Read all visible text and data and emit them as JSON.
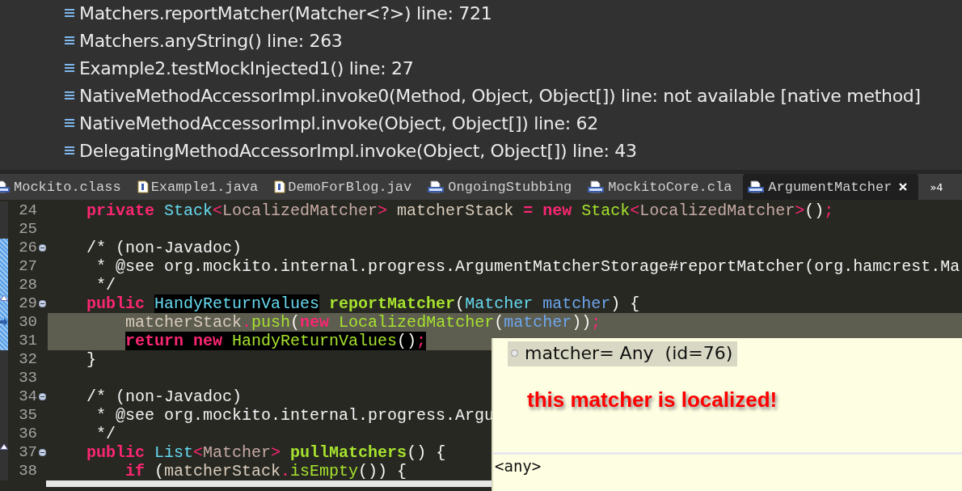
{
  "stack_frames": [
    {
      "text": "Matchers.reportMatcher(Matcher<?>) line: 721"
    },
    {
      "text": "Matchers.anyString() line: 263"
    },
    {
      "text": "Example2.testMockInjected1() line: 27"
    },
    {
      "text": "NativeMethodAccessorImpl.invoke0(Method, Object, Object[]) line: not available [native method]"
    },
    {
      "text": "NativeMethodAccessorImpl.invoke(Object, Object[]) line: 62"
    },
    {
      "text": "DelegatingMethodAccessorImpl.invoke(Object, Object[]) line: 43"
    }
  ],
  "editor_tabs": [
    {
      "label": "Mockito.class",
      "kind": "class",
      "selected": false
    },
    {
      "label": "Example1.java",
      "kind": "java",
      "selected": false
    },
    {
      "label": "DemoForBlog.jav",
      "kind": "java",
      "selected": false
    },
    {
      "label": "OngoingStubbing",
      "kind": "class",
      "selected": false
    },
    {
      "label": "MockitoCore.cla",
      "kind": "class",
      "selected": false
    },
    {
      "label": "ArgumentMatcher",
      "kind": "class",
      "selected": true
    }
  ],
  "tab_overflow": "»4",
  "code_lines": [
    {
      "number": "24",
      "selected": false,
      "changed": false,
      "foldable": false,
      "bookmarked": false,
      "current": false,
      "tokens": [
        {
          "text": "    private ",
          "kind": "keyword"
        },
        {
          "text": "Stack",
          "kind": "type"
        },
        {
          "text": "<",
          "kind": "operator"
        },
        {
          "text": "LocalizedMatcher",
          "kind": "generic"
        },
        {
          "text": ">",
          "kind": "operator"
        },
        {
          "text": " matcherStack ",
          "kind": "field"
        },
        {
          "text": "= new ",
          "kind": "keyword"
        },
        {
          "text": "Stack",
          "kind": "call"
        },
        {
          "text": "<",
          "kind": "operator"
        },
        {
          "text": "LocalizedMatcher",
          "kind": "generic"
        },
        {
          "text": ">",
          "kind": "operator"
        },
        {
          "text": "()"
        },
        {
          "text": ";",
          "kind": "operator"
        }
      ]
    },
    {
      "number": "25",
      "selected": false,
      "changed": false,
      "foldable": false,
      "bookmarked": false,
      "current": false
    },
    {
      "number": "26",
      "selected": false,
      "changed": true,
      "foldable": true,
      "bookmarked": false,
      "current": false,
      "tokens": [
        {
          "text": "    /* (non-Javadoc)",
          "kind": "comment"
        }
      ]
    },
    {
      "number": "27",
      "selected": false,
      "changed": true,
      "foldable": false,
      "bookmarked": false,
      "current": false,
      "tokens": [
        {
          "text": "     * @see org.mockito.internal.progress.ArgumentMatcherStorage#reportMatcher(org.hamcrest.Ma",
          "kind": "comment"
        }
      ]
    },
    {
      "number": "28",
      "selected": false,
      "changed": true,
      "foldable": false,
      "bookmarked": false,
      "current": false,
      "tokens": [
        {
          "text": "     */",
          "kind": "comment"
        }
      ]
    },
    {
      "number": "29",
      "selected": false,
      "changed": true,
      "foldable": true,
      "bookmarked": true,
      "current": false,
      "tokens": [
        {
          "text": "    public ",
          "kind": "keyword"
        },
        {
          "text": "HandyReturnValues",
          "kind": "type",
          "marked": true
        },
        {
          "text": " reportMatcher",
          "kind": "decl"
        },
        {
          "text": "("
        },
        {
          "text": "Matcher ",
          "kind": "type"
        },
        {
          "text": "matcher",
          "kind": "param"
        },
        {
          "text": ") {"
        }
      ]
    },
    {
      "number": "30",
      "selected": true,
      "changed": true,
      "foldable": false,
      "bookmarked": false,
      "current": true,
      "tokens": [
        {
          "text": "        matcherStack",
          "kind": "field"
        },
        {
          "text": ".",
          "kind": "operator"
        },
        {
          "text": "push",
          "kind": "call"
        },
        {
          "text": "("
        },
        {
          "text": "new ",
          "kind": "keyword"
        },
        {
          "text": "LocalizedMatcher",
          "kind": "call"
        },
        {
          "text": "("
        },
        {
          "text": "matcher",
          "kind": "param"
        },
        {
          "text": "))"
        },
        {
          "text": ";",
          "kind": "operator"
        }
      ]
    },
    {
      "number": "31",
      "selected": true,
      "changed": true,
      "foldable": false,
      "bookmarked": false,
      "current": false,
      "tokens": [
        {
          "text": "        return new ",
          "kind": "keyword",
          "marked": true
        },
        {
          "text": "HandyReturnValues",
          "kind": "call",
          "marked": true
        },
        {
          "text": "()",
          "marked": true
        },
        {
          "text": ";",
          "kind": "operator",
          "marked": true
        }
      ]
    },
    {
      "number": "32",
      "selected": false,
      "changed": false,
      "foldable": false,
      "bookmarked": false,
      "current": false,
      "tokens": [
        {
          "text": "    }"
        }
      ]
    },
    {
      "number": "33",
      "selected": false,
      "changed": false,
      "foldable": false,
      "bookmarked": false,
      "current": false
    },
    {
      "number": "34",
      "selected": false,
      "changed": false,
      "foldable": true,
      "bookmarked": false,
      "current": false,
      "tokens": [
        {
          "text": "    /* (non-Javadoc)",
          "kind": "comment"
        }
      ]
    },
    {
      "number": "35",
      "selected": false,
      "changed": false,
      "foldable": false,
      "bookmarked": false,
      "current": false,
      "tokens": [
        {
          "text": "     * @see org.mockito.internal.progress.Argu",
          "kind": "comment"
        }
      ]
    },
    {
      "number": "36",
      "selected": false,
      "changed": false,
      "foldable": false,
      "bookmarked": false,
      "current": false,
      "tokens": [
        {
          "text": "     */",
          "kind": "comment"
        }
      ]
    },
    {
      "number": "37",
      "selected": false,
      "changed": false,
      "foldable": true,
      "bookmarked": true,
      "current": false,
      "tokens": [
        {
          "text": "    public ",
          "kind": "keyword"
        },
        {
          "text": "List",
          "kind": "type"
        },
        {
          "text": "<",
          "kind": "operator"
        },
        {
          "text": "Matcher",
          "kind": "generic"
        },
        {
          "text": ">",
          "kind": "operator"
        },
        {
          "text": " pullMatchers",
          "kind": "decl"
        },
        {
          "text": "() {"
        }
      ]
    },
    {
      "number": "38",
      "selected": false,
      "changed": false,
      "foldable": false,
      "bookmarked": false,
      "current": false,
      "tokens": [
        {
          "text": "        if",
          "kind": "keyword"
        },
        {
          "text": " ("
        },
        {
          "text": "matcherStack",
          "kind": "field"
        },
        {
          "text": ".",
          "kind": "operator"
        },
        {
          "text": "isEmpty",
          "kind": "call"
        },
        {
          "text": "()) {"
        }
      ]
    }
  ],
  "hover_popup": {
    "variable": "matcher= Any  (id=76)",
    "note": "this matcher is localized!",
    "detail": "<any>"
  }
}
